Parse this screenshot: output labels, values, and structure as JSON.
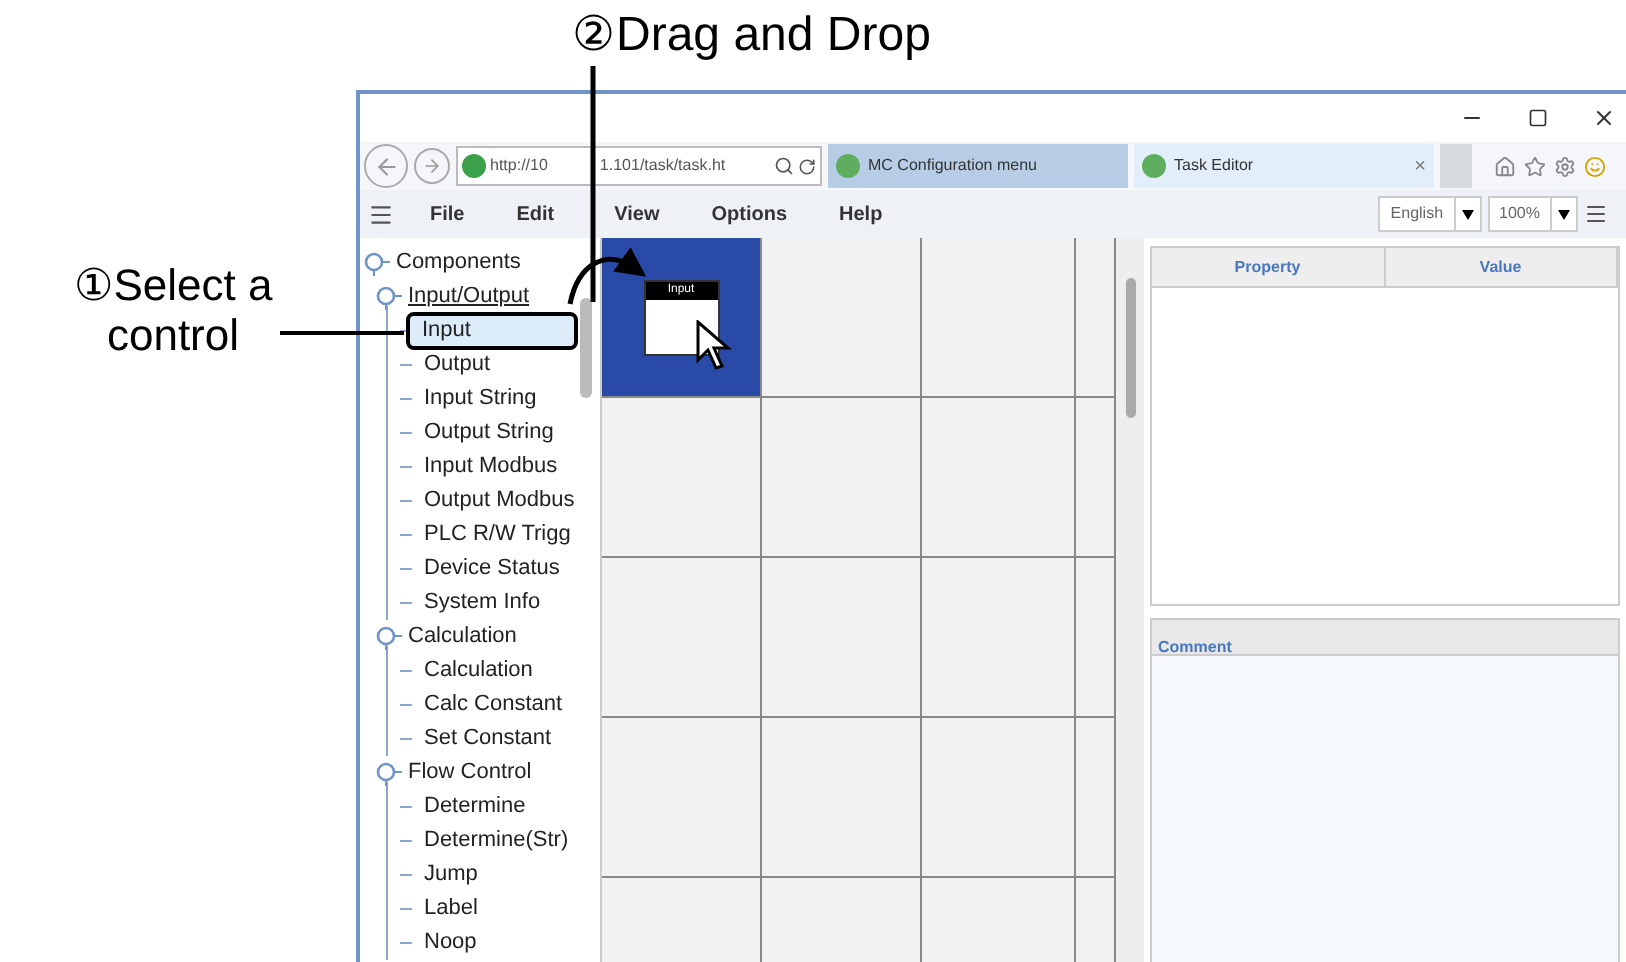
{
  "annotations": [
    {
      "kind": "select",
      "text": "①Select a control"
    },
    {
      "kind": "drag",
      "text": "②Drag and Drop"
    }
  ],
  "browser": {
    "address_parts": [
      "http://10",
      "1.101/task/task.ht"
    ],
    "tabs": [
      {
        "label": "MC Configuration menu",
        "selected": false
      },
      {
        "label": "Task Editor",
        "selected": true
      }
    ],
    "tab_close": "×"
  },
  "menu": [
    "File",
    "Edit",
    "View",
    "Options",
    "Help"
  ],
  "language": "English",
  "zoom": "100%",
  "tree": [
    {
      "label": "Components",
      "expanded": true,
      "children": [
        {
          "label": "Input/Output",
          "expanded": true,
          "underlined": true,
          "children": [
            {
              "label": "Input",
              "selected": true
            },
            {
              "label": "Output",
              "selected": false
            },
            {
              "label": "Input String",
              "selected": false
            },
            {
              "label": "Output String",
              "selected": false
            },
            {
              "label": "Input Modbus",
              "selected": false
            },
            {
              "label": "Output Modbus",
              "selected": false
            },
            {
              "label": "PLC R/W Trigg",
              "selected": false
            },
            {
              "label": "Device Status",
              "selected": false
            },
            {
              "label": "System Info",
              "selected": false
            }
          ]
        },
        {
          "label": "Calculation",
          "expanded": true,
          "underlined": false,
          "children": [
            {
              "label": "Calculation",
              "selected": false
            },
            {
              "label": "Calc Constant",
              "selected": false
            },
            {
              "label": "Set Constant",
              "selected": false
            }
          ]
        },
        {
          "label": "Flow Control",
          "expanded": true,
          "underlined": false,
          "children": [
            {
              "label": "Determine",
              "selected": false
            },
            {
              "label": "Determine(Str)",
              "selected": false
            },
            {
              "label": "Jump",
              "selected": false
            },
            {
              "label": "Label",
              "selected": false
            },
            {
              "label": "Noop",
              "selected": false
            }
          ]
        }
      ]
    }
  ],
  "canvas": {
    "node_title": "Input",
    "cell_selected": true
  },
  "properties": {
    "columns": [
      "Property",
      "Value"
    ]
  },
  "comment": {
    "title": "Comment"
  }
}
